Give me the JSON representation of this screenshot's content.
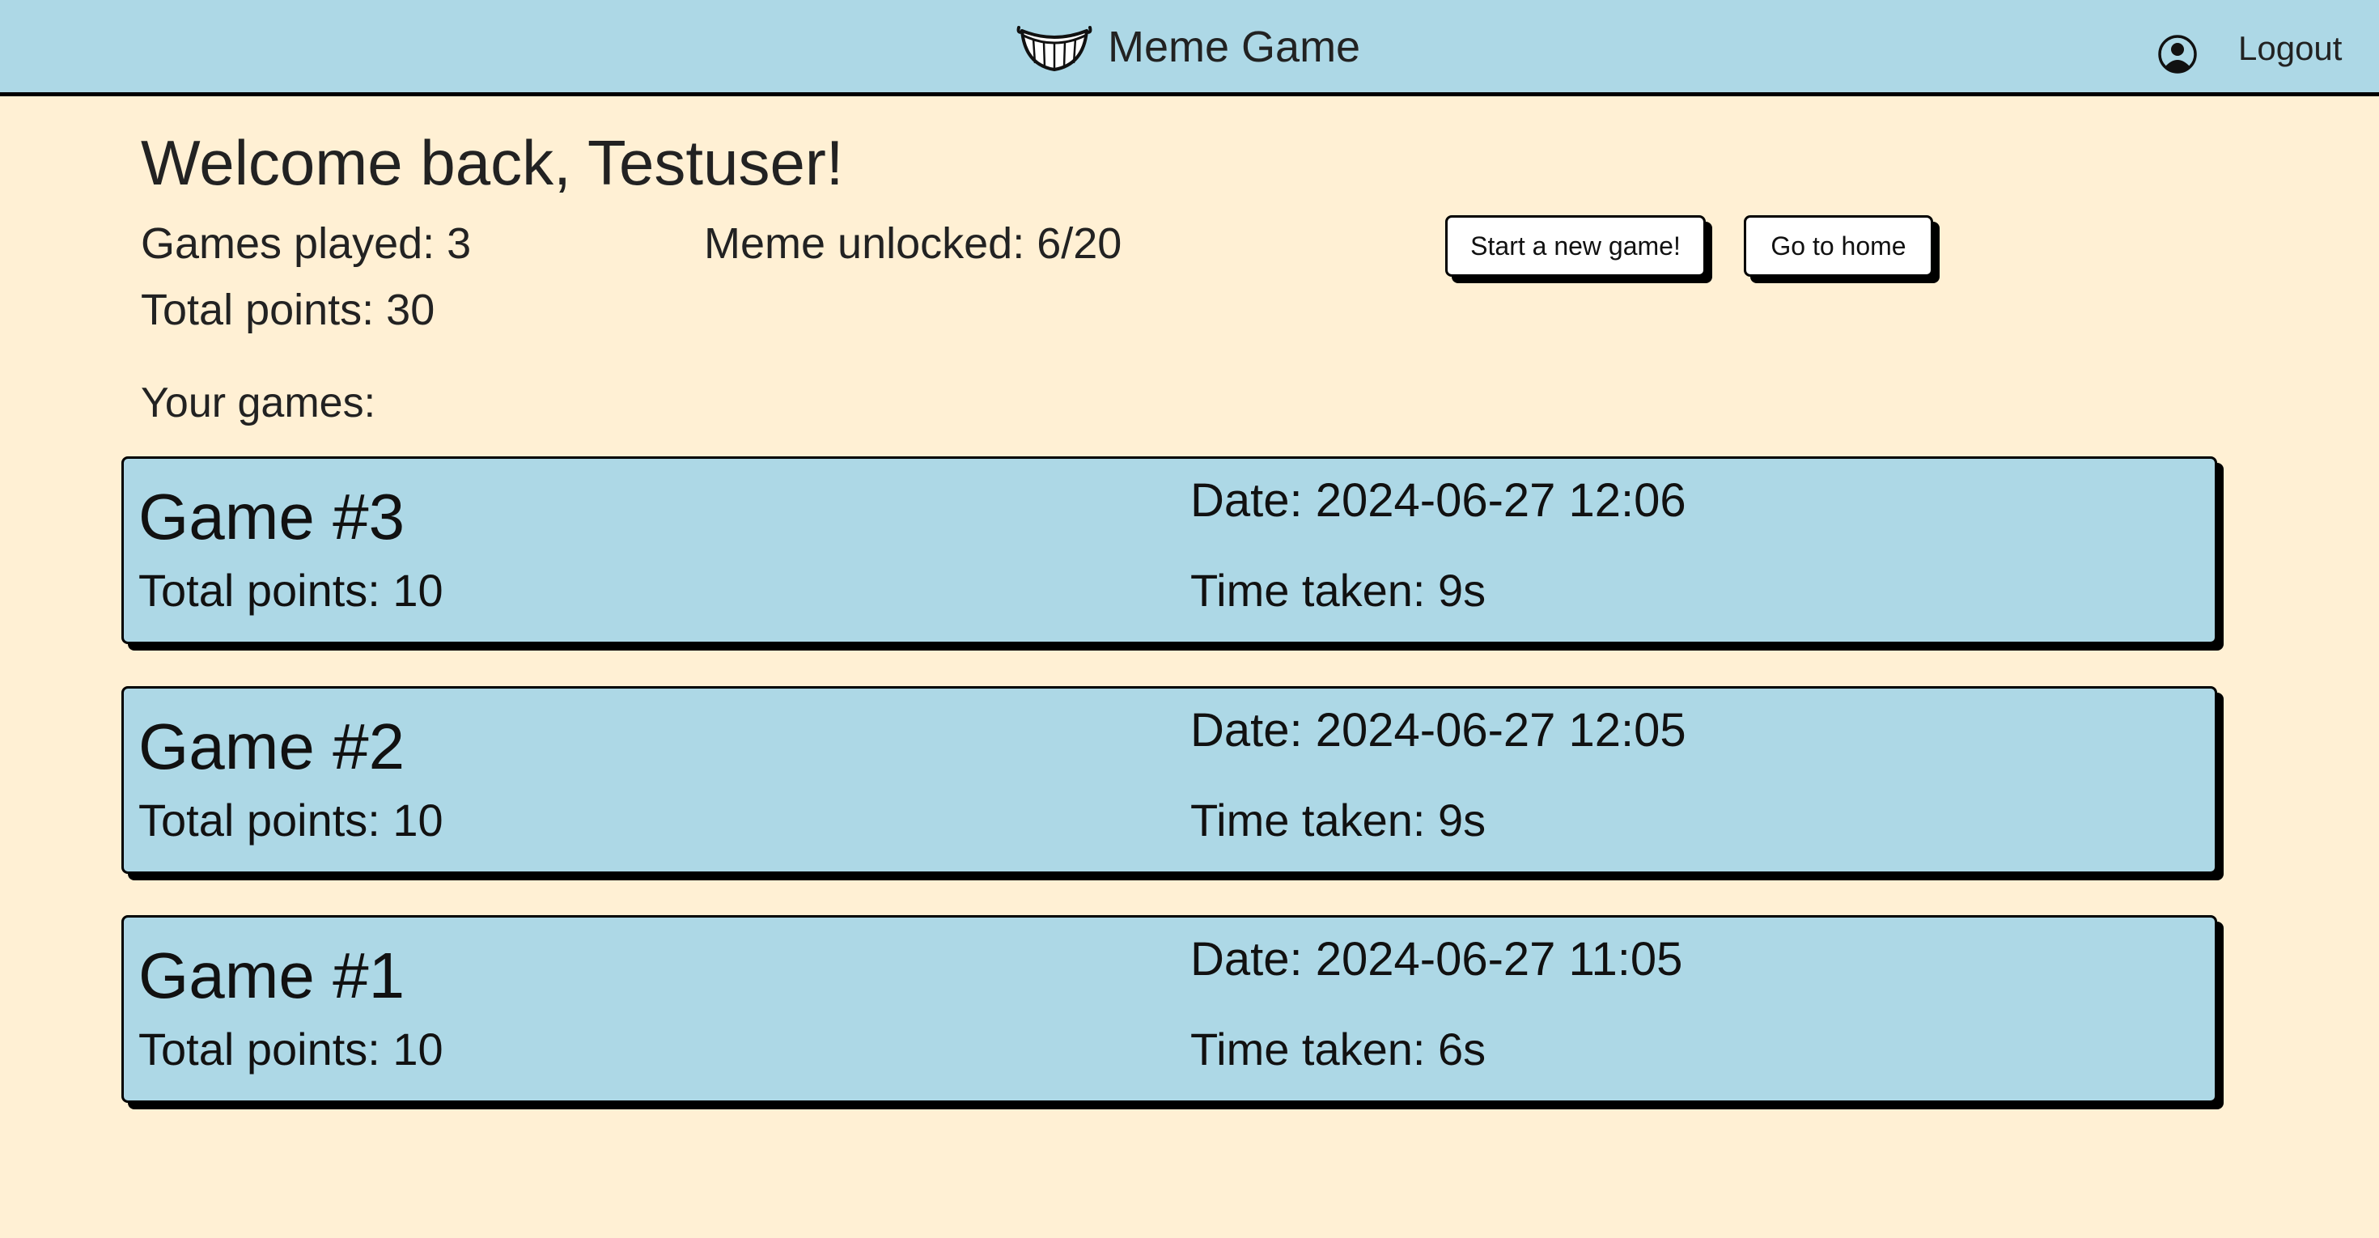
{
  "header": {
    "brand_title": "Meme Game",
    "logo_icon": "grin-mouth-icon",
    "user_icon": "user-circle-icon",
    "logout_label": "Logout",
    "background_color": "#add8e6"
  },
  "welcome": {
    "heading": "Welcome back, Testuser!",
    "games_played": "Games played: 3",
    "memes_unlocked": "Meme unlocked: 6/20",
    "total_points": "Total points: 30"
  },
  "actions": {
    "new_game_label": "Start a new game!",
    "home_label": "Go to home"
  },
  "games_section": {
    "heading": "Your games:",
    "games": [
      {
        "title": "Game #3",
        "points": "Total points: 10",
        "date": "Date: 2024-06-27 12:06",
        "time_taken": "Time taken: 9s"
      },
      {
        "title": "Game #2",
        "points": "Total points: 10",
        "date": "Date: 2024-06-27 12:05",
        "time_taken": "Time taken: 9s"
      },
      {
        "title": "Game #1",
        "points": "Total points: 10",
        "date": "Date: 2024-06-27 11:05",
        "time_taken": "Time taken: 6s"
      }
    ]
  },
  "colors": {
    "page_background": "#fff0d4",
    "card_background": "#add8e6",
    "border": "#000000"
  }
}
